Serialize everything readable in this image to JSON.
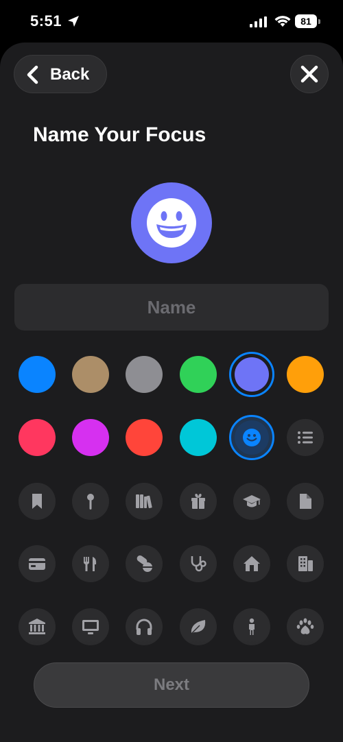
{
  "status": {
    "time": "5:51",
    "battery": "81"
  },
  "header": {
    "back_label": "Back",
    "title": "Name Your Focus"
  },
  "focus": {
    "color": "#6e74f6",
    "icon": "smiley-icon"
  },
  "name_field": {
    "placeholder": "Name",
    "value": ""
  },
  "colors": [
    "#0a84ff",
    "#ac8e68",
    "#8e8e93",
    "#30d158",
    "#6e74f6",
    "#ff9f0a",
    "#ff375f",
    "#d630f0",
    "#ff453a",
    "#00c7d8"
  ],
  "selected_color": "#6e74f6",
  "icons": [
    "smiley-icon",
    "list-icon",
    "bookmark-icon",
    "pin-icon",
    "books-icon",
    "gift-icon",
    "graduation-cap-icon",
    "document-icon",
    "credit-card-icon",
    "fork-knife-icon",
    "pills-icon",
    "stethoscope-icon",
    "house-icon",
    "building-icon",
    "bank-icon",
    "monitor-icon",
    "headphones-icon",
    "leaf-icon",
    "person-icon",
    "paw-icon"
  ],
  "selected_icon": "smiley-icon",
  "footer": {
    "next_label": "Next"
  },
  "theme": {
    "accent": "#0a84ff",
    "icon_gray": "#a1a1a6"
  }
}
